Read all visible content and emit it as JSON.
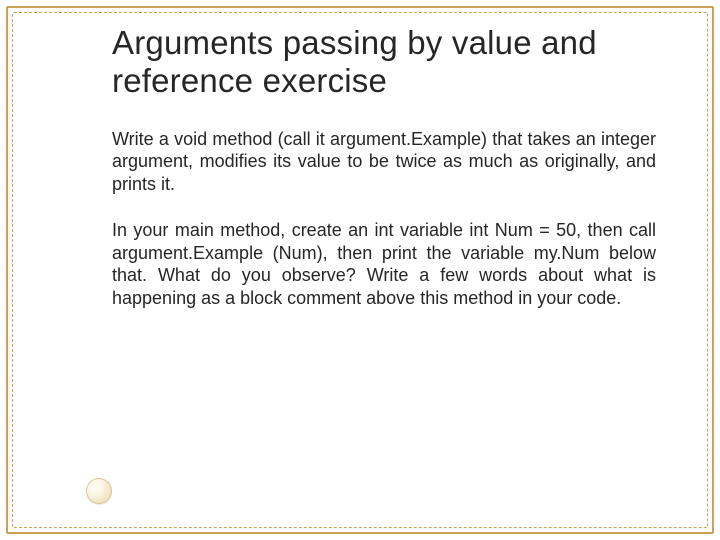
{
  "title": "Arguments passing by value and reference exercise",
  "paragraphs": {
    "p1": "Write a void method (call it argument.Example) that takes an integer argument, modifies its value to be twice as much as originally, and prints it.",
    "p2": "In your main method, create an int variable int Num = 50, then call argument.Example (Num), then print the variable my.Num below that. What do you observe? Write a few words about what is happening as a block comment above this method in your code."
  }
}
